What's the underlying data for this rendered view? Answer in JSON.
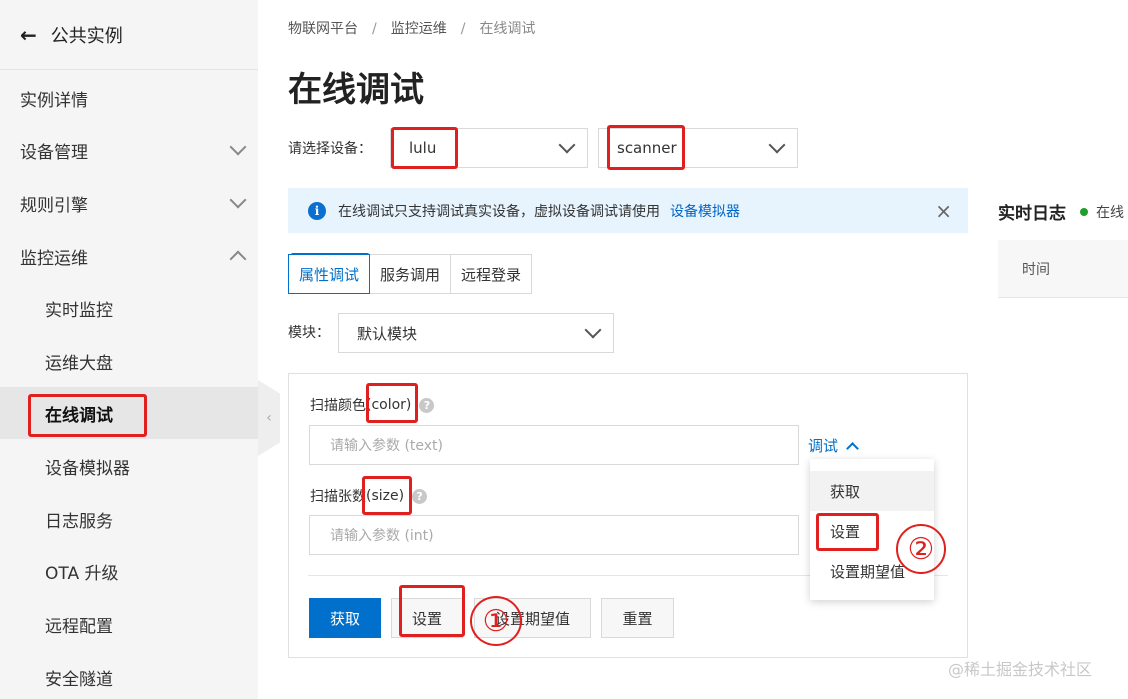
{
  "sidebar": {
    "back_label": "公共实例",
    "items": [
      {
        "label": "实例详情",
        "chevron": ""
      },
      {
        "label": "设备管理",
        "chevron": "down"
      },
      {
        "label": "规则引擎",
        "chevron": "down"
      },
      {
        "label": "监控运维",
        "chevron": "up"
      },
      {
        "label": "实时监控"
      },
      {
        "label": "运维大盘"
      },
      {
        "label": "在线调试",
        "active": true
      },
      {
        "label": "设备模拟器"
      },
      {
        "label": "日志服务"
      },
      {
        "label": "OTA 升级"
      },
      {
        "label": "远程配置"
      },
      {
        "label": "安全隧道"
      }
    ]
  },
  "breadcrumb": {
    "items": [
      "物联网平台",
      "监控运维",
      "在线调试"
    ],
    "separator": "/"
  },
  "page_title": "在线调试",
  "device_select": {
    "label": "请选择设备：",
    "product": "lulu",
    "device": "scanner"
  },
  "info_bar": {
    "text": "在线调试只支持调试真实设备，虚拟设备调试请使用",
    "link": "设备模拟器",
    "close": "×"
  },
  "tabs": [
    {
      "label": "属性调试",
      "active": true
    },
    {
      "label": "服务调用"
    },
    {
      "label": "远程登录"
    }
  ],
  "module": {
    "label": "模块：",
    "value": "默认模块"
  },
  "properties": [
    {
      "name": "扫描颜色",
      "identifier": "(color)",
      "placeholder": "请输入参数 (text)"
    },
    {
      "name": "扫描张数",
      "identifier": "(size)",
      "placeholder": "请输入参数 (int)"
    }
  ],
  "debug_link": "调试",
  "dropdown": [
    "获取",
    "设置",
    "设置期望值"
  ],
  "buttons": {
    "get": "获取",
    "set": "设置",
    "set_expected": "设置期望值",
    "reset": "重置"
  },
  "annotations": {
    "circle_1": "①",
    "circle_2": "②"
  },
  "log": {
    "title": "实时日志",
    "status": "在线",
    "column_time": "时间"
  },
  "watermark": "@稀土掘金技术社区",
  "colors": {
    "primary": "#0070cc",
    "highlight_red": "#e0201e",
    "online_green": "#1fa02e"
  }
}
